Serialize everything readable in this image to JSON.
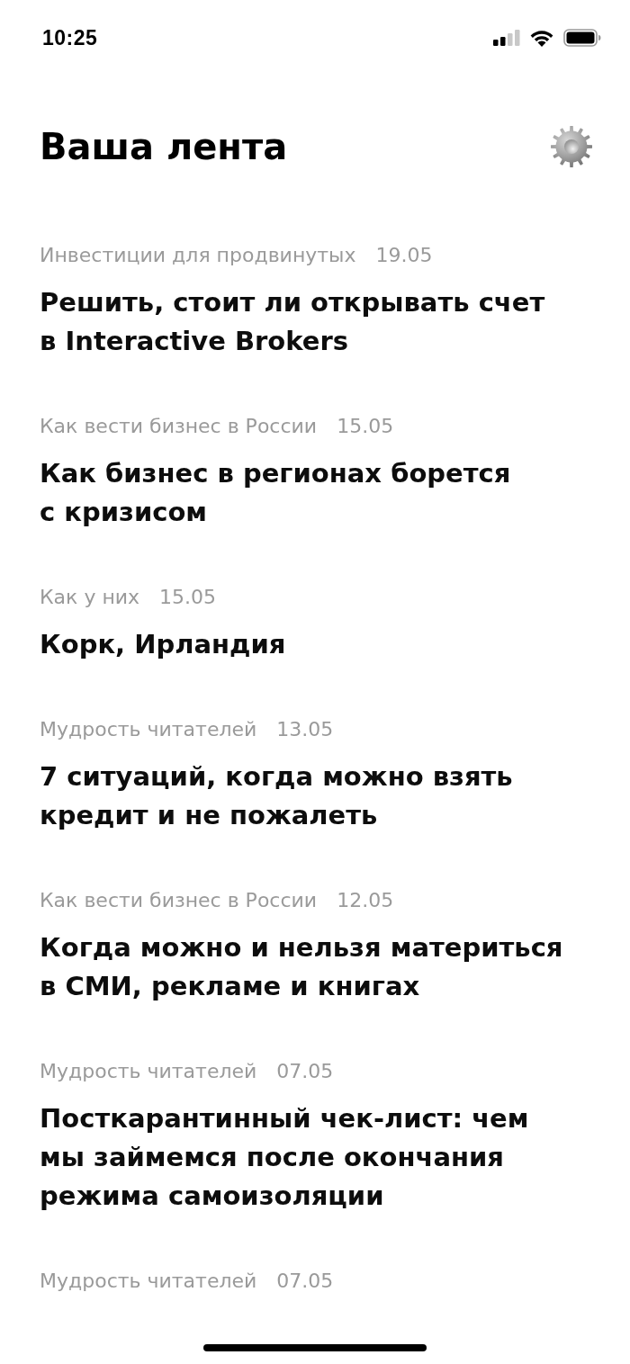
{
  "status_bar": {
    "time": "10:25"
  },
  "header": {
    "title": "Ваша лента"
  },
  "feed": [
    {
      "section": "Инвестиции для продвинутых",
      "date": "19.05",
      "headline": "Решить, стоит ли открывать счет в Interactive Brokers"
    },
    {
      "section": "Как вести бизнес в России",
      "date": "15.05",
      "headline": "Как бизнес в регионах борется с кризисом"
    },
    {
      "section": "Как у них",
      "date": "15.05",
      "headline": "Корк, Ирландия"
    },
    {
      "section": "Мудрость читателей",
      "date": "13.05",
      "headline": "7 ситуаций, когда можно взять кредит и не пожалеть"
    },
    {
      "section": "Как вести бизнес в России",
      "date": "12.05",
      "headline": "Когда можно и нельзя материться в СМИ, рекламе и книгах"
    },
    {
      "section": "Мудрость читателей",
      "date": "07.05",
      "headline": "Посткарантинный чек-лист: чем мы займемся после окончания режима самоизоляции"
    },
    {
      "section": "Мудрость читателей",
      "date": "07.05"
    }
  ]
}
